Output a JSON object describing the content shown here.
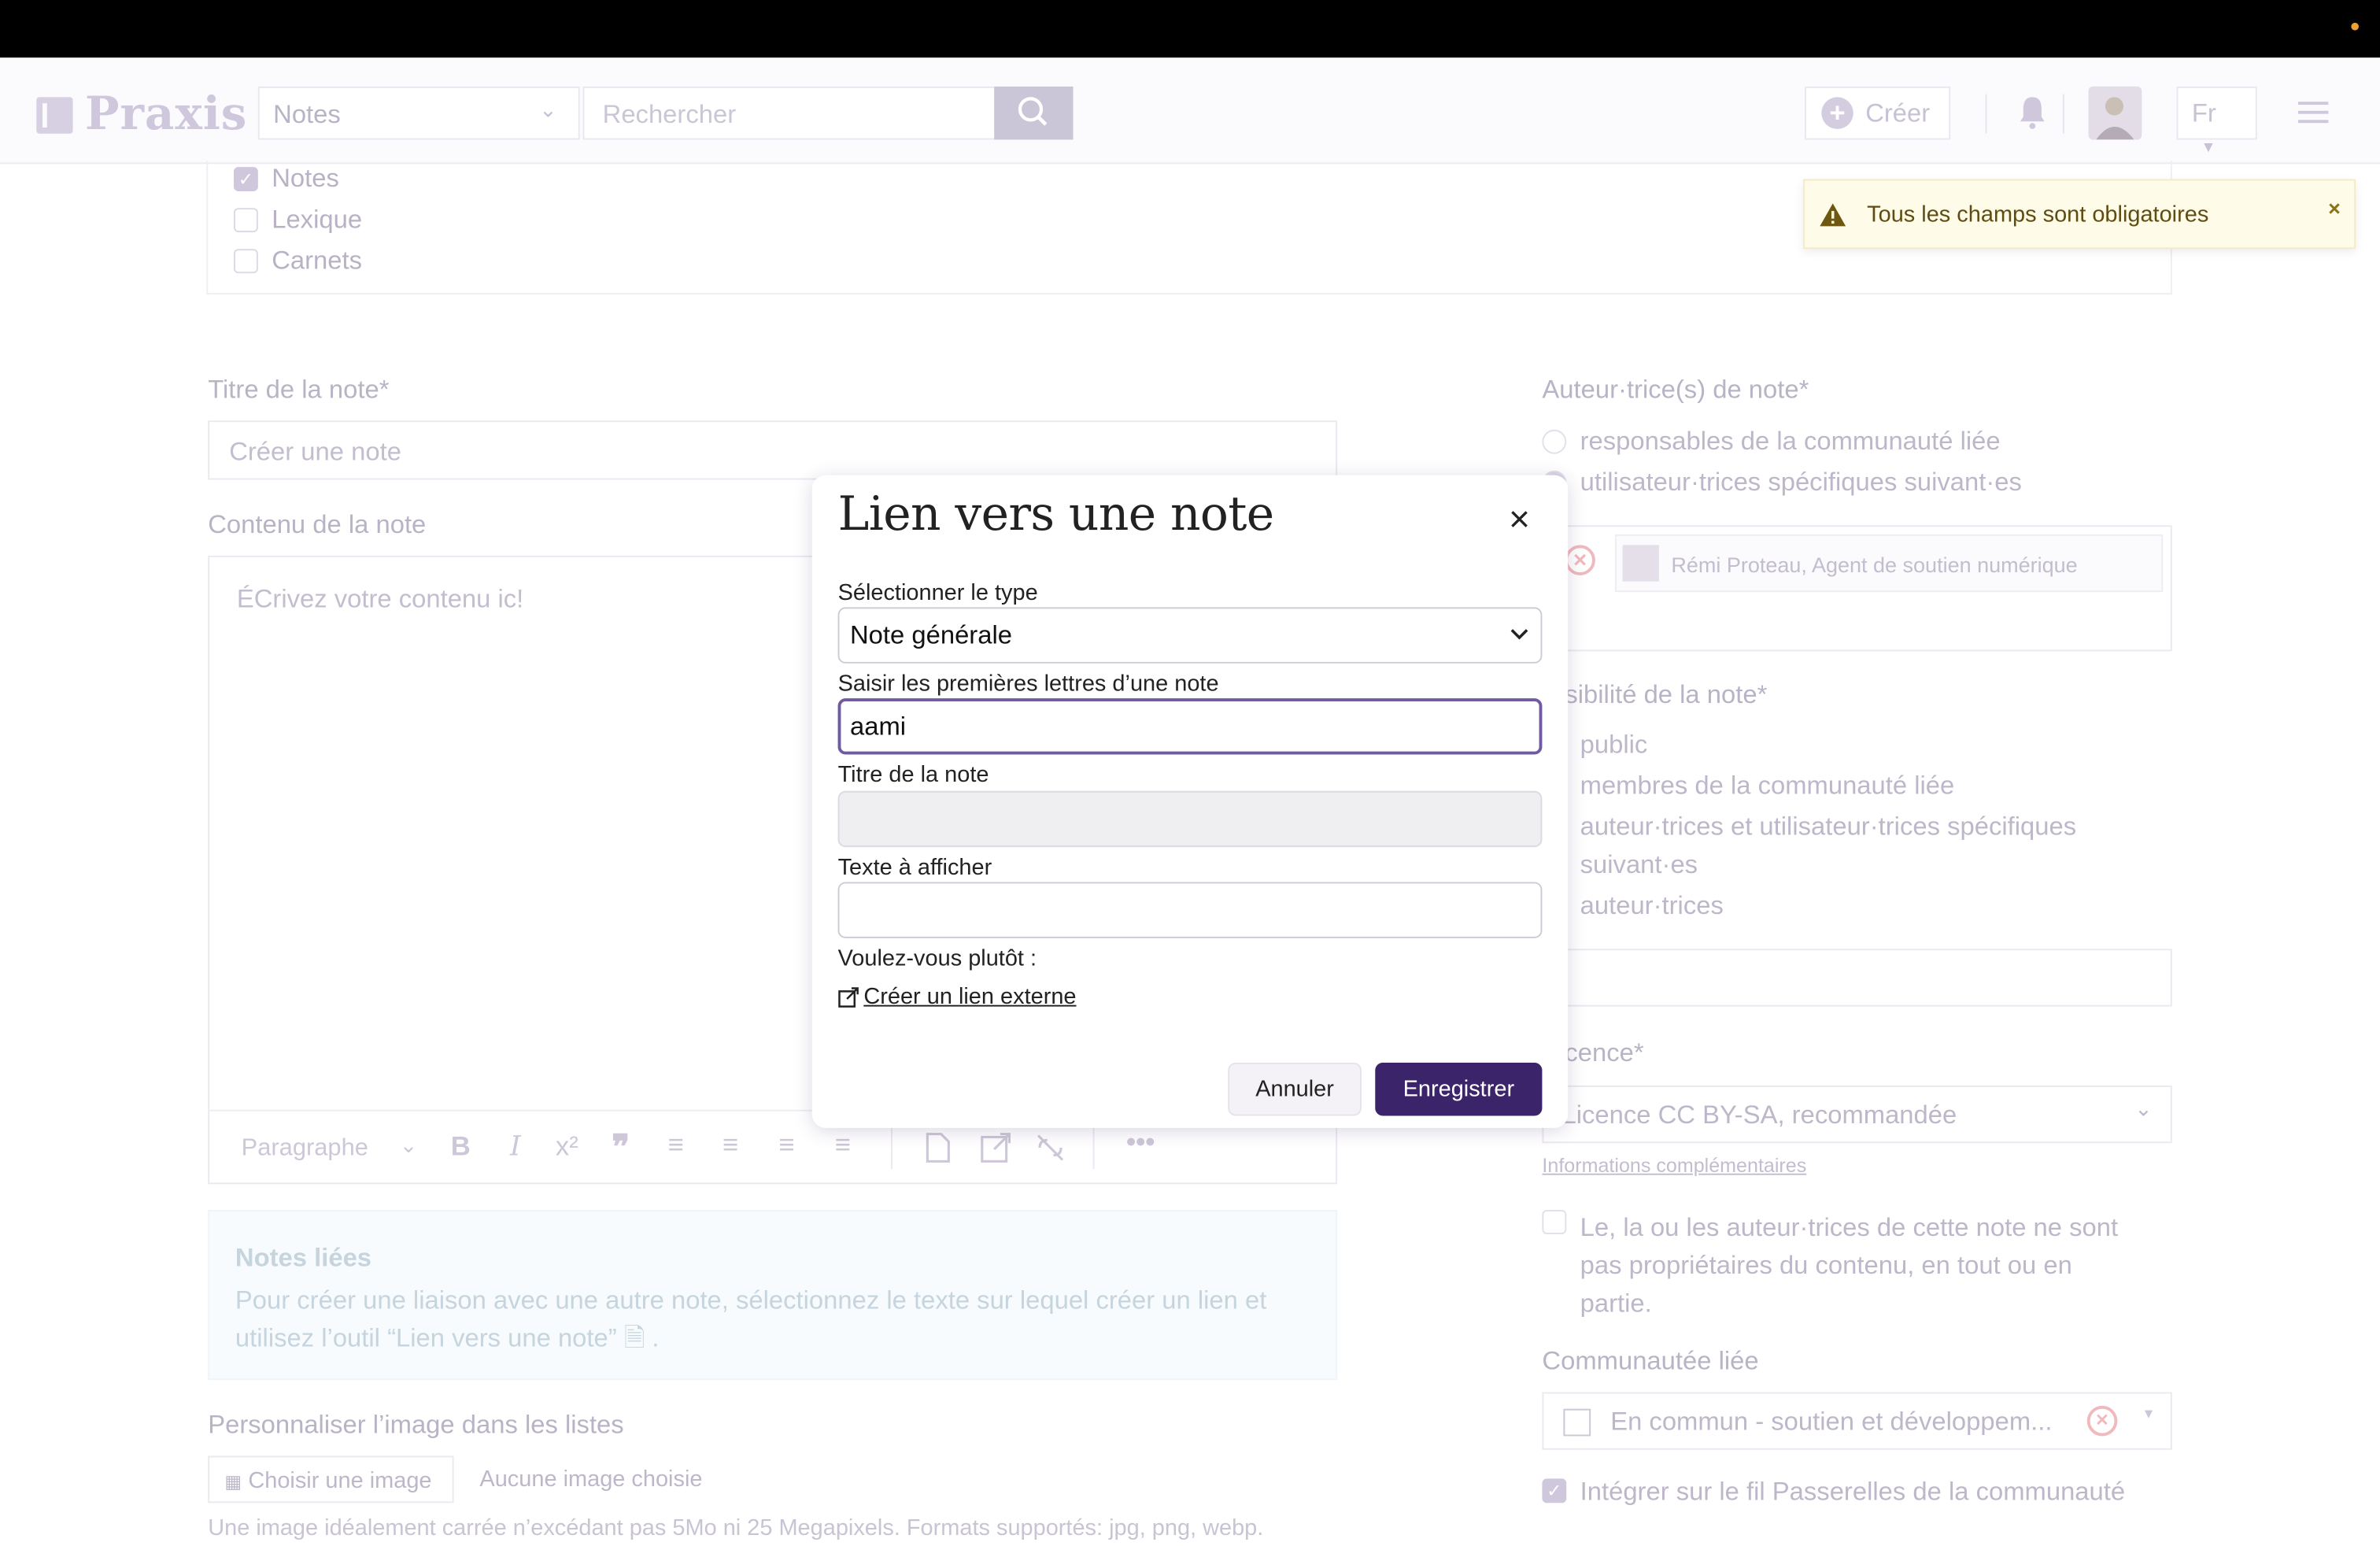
{
  "nav": {
    "logo_text": "Praxis",
    "section_select": "Notes",
    "search_placeholder": "Rechercher",
    "create_label": "Créer",
    "lang": "Fr"
  },
  "filters": [
    {
      "label": "Notes",
      "checked": true
    },
    {
      "label": "Lexique",
      "checked": false
    },
    {
      "label": "Carnets",
      "checked": false
    }
  ],
  "form": {
    "title_label": "Titre de la note*",
    "title_placeholder": "Créer une note",
    "content_label": "Contenu de la note",
    "content_placeholder": "ÉCrivez votre contenu ic!",
    "toolbar_format": "Paragraphe",
    "linked_notes_title": "Notes liées",
    "linked_notes_text": "Pour créer une liaison avec une autre note, sélectionnez le texte sur lequel créer un lien et utilisez l’outil “Lien vers une note”",
    "linked_notes_end": ".",
    "image_label": "Personnaliser l’image dans les listes",
    "choose_image_btn": "Choisir une image",
    "no_image": "Aucune image choisie",
    "image_help": "Une image idéalement carrée n’excédant pas 5Mo ni 25 Megapixels. Formats supportés: jpg, png, webp."
  },
  "right": {
    "authors_label": "Auteur·trice(s) de note*",
    "authors_opt1": "responsables de la communauté liée",
    "authors_opt2": "utilisateur·trices spécifiques suivant·es",
    "author_chip": "Rémi Proteau, Agent de soutien numérique",
    "visibility_label": "sibilité de la note*",
    "vis_opt1": "public",
    "vis_opt2": "membres de la communauté liée",
    "vis_opt3_a": "auteur·trices et utilisateur·trices spécifiques",
    "vis_opt3_b": "suivant·es",
    "vis_opt4": "auteur·trices",
    "licence_label": "cence*",
    "licence_value": "Licence CC BY-SA, recommandée",
    "more_info": "Informations complémentaires",
    "ownership_a": "Le, la ou les auteur·trices de cette note ne sont",
    "ownership_b": "pas propriétaires du contenu, en tout ou en",
    "ownership_c": "partie.",
    "community_label": "Communautée liée",
    "community_value": "En commun - soutien et développem...",
    "integrate_label": "Intégrer sur le fil Passerelles de la communauté"
  },
  "toast": {
    "message": "Tous les champs sont obligatoires",
    "close": "×",
    "color": "#fffbe9"
  },
  "modal": {
    "title": "Lien vers une note",
    "close": "×",
    "type_label": "Sélectionner le type",
    "type_value": "Note générale",
    "search_label": "Saisir les premières lettres d’une note",
    "search_value": "aami",
    "note_title_label": "Titre de la note",
    "note_title_value": "",
    "display_label": "Texte à afficher",
    "display_value": "",
    "alt_label": "Voulez-vous plutôt :",
    "external_link": "Créer un lien externe",
    "cancel": "Annuler",
    "save": "Enregistrer",
    "accent": "#3b2469"
  }
}
